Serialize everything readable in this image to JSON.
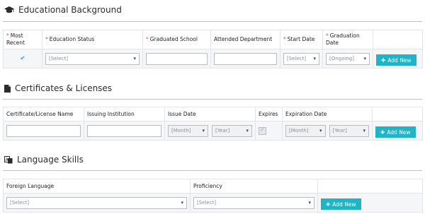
{
  "education": {
    "title": "Educational Background",
    "headers": {
      "most_recent": "Most Recent",
      "status": "Education Status",
      "school": "Graduated School",
      "department": "Attended Department",
      "start": "Start Date",
      "grad": "Graduation Date"
    },
    "required_mark": "*",
    "check_glyph": "✔",
    "status_value": "[Select]",
    "start_value": "[Select]",
    "grad_value": "[Ongoing]",
    "add_label": "Add New"
  },
  "certificates": {
    "title": "Certificates & Licenses",
    "headers": {
      "name": "Certificate/License Name",
      "institution": "Issuing Institution",
      "issue": "Issue Date",
      "expires": "Expires",
      "expiration": "Expiration Date"
    },
    "issue_month": "[Month]",
    "issue_year": "[Year]",
    "exp_month": "[Month]",
    "exp_year": "[Year]",
    "add_label": "Add New"
  },
  "languages": {
    "title": "Language Skills",
    "headers": {
      "language": "Foreign Language",
      "proficiency": "Proficiency"
    },
    "language_value": "[Select]",
    "proficiency_value": "[Select]",
    "add_label": "Add New"
  },
  "icons": {
    "education": "graduation-cap-icon",
    "certificates": "document-icon",
    "languages": "language-icon",
    "add": "plus-icon"
  },
  "colors": {
    "accent": "#1fb5c7",
    "required": "#d9534f"
  }
}
